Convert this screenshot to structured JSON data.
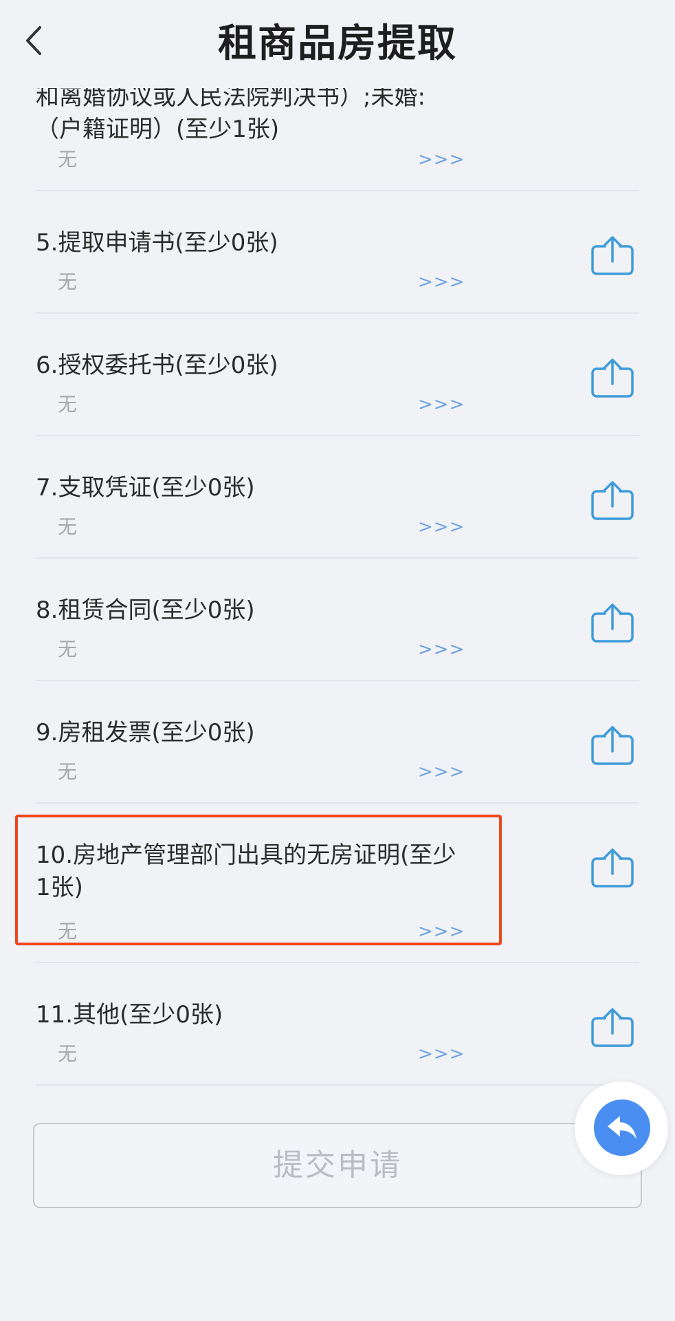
{
  "header": {
    "title": "租商品房提取"
  },
  "items": [
    {
      "title": "和离婚协议或人民法院判决书）;未婚:（户籍证明）(至少1张)",
      "value": "无",
      "more": ">>>"
    },
    {
      "title": "5.提取申请书(至少0张)",
      "value": "无",
      "more": ">>>"
    },
    {
      "title": "6.授权委托书(至少0张)",
      "value": "无",
      "more": ">>>"
    },
    {
      "title": "7.支取凭证(至少0张)",
      "value": "无",
      "more": ">>>"
    },
    {
      "title": "8.租赁合同(至少0张)",
      "value": "无",
      "more": ">>>"
    },
    {
      "title": "9.房租发票(至少0张)",
      "value": "无",
      "more": ">>>"
    },
    {
      "title": "10.房地产管理部门出具的无房证明(至少1张)",
      "value": "无",
      "more": ">>>"
    },
    {
      "title": "11.其他(至少0张)",
      "value": "无",
      "more": ">>>"
    }
  ],
  "submit_label": "提交申请",
  "colors": {
    "accent": "#4a8ef2",
    "link": "#6fa3e0",
    "highlight": "#f0461e",
    "background": "#f0f2f6"
  }
}
